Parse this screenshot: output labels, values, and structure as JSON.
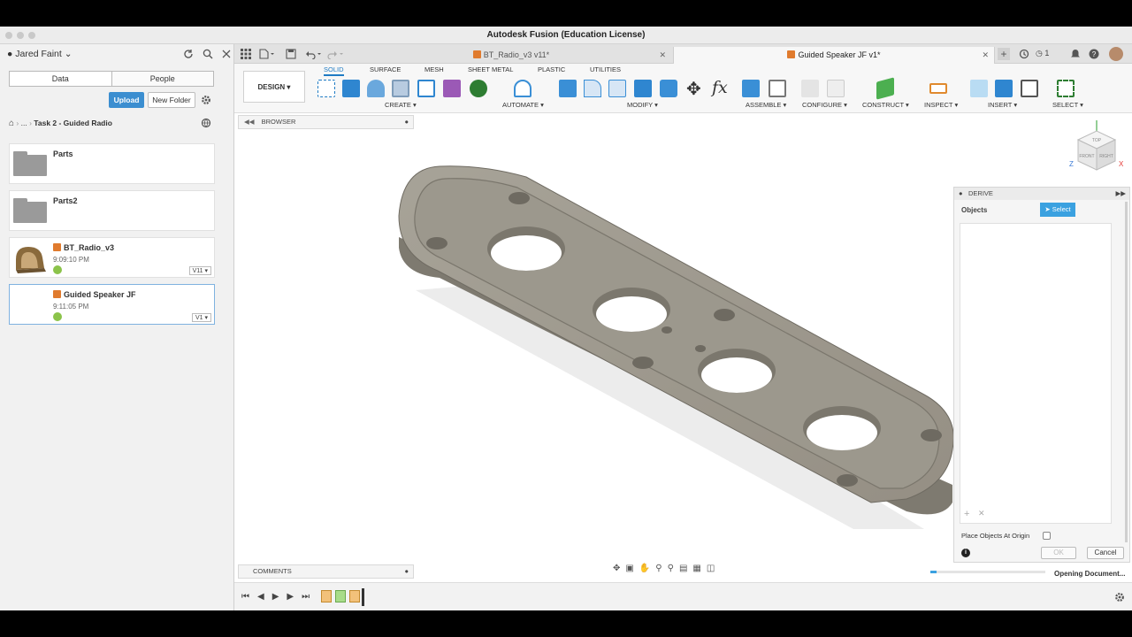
{
  "window": {
    "title": "Autodesk Fusion (Education License)"
  },
  "data_panel": {
    "user": "Jared Faint",
    "tabs": [
      "Data",
      "People"
    ],
    "upload_label": "Upload",
    "new_folder_label": "New Folder",
    "breadcrumb_ellipsis": "...",
    "breadcrumb_current": "Task 2 - Guided Radio",
    "items": [
      {
        "name": "Parts",
        "type": "folder"
      },
      {
        "name": "Parts2",
        "type": "folder"
      },
      {
        "name": "BT_Radio_v3",
        "time": "9:09:10 PM",
        "version": "V11"
      },
      {
        "name": "Guided Speaker JF",
        "time": "9:11:05 PM",
        "version": "V1"
      }
    ]
  },
  "doc_tabs": [
    {
      "label": "BT_Radio_v3 v11*"
    },
    {
      "label": "Guided Speaker JF v1*"
    }
  ],
  "header_status": {
    "jobs_count": "1"
  },
  "toolbar": {
    "workspace": "DESIGN",
    "subtabs": [
      "SOLID",
      "SURFACE",
      "MESH",
      "SHEET METAL",
      "PLASTIC",
      "UTILITIES"
    ],
    "groups": [
      "CREATE",
      "AUTOMATE",
      "MODIFY",
      "ASSEMBLE",
      "CONFIGURE",
      "CONSTRUCT",
      "INSPECT",
      "INSERT",
      "SELECT"
    ]
  },
  "browser": {
    "label": "BROWSER"
  },
  "comments": {
    "label": "COMMENTS"
  },
  "viewcube": {
    "top": "TOP",
    "front": "FRONT",
    "right": "RIGHT",
    "axis_x": "X",
    "axis_z": "Z"
  },
  "derive_dialog": {
    "title": "DERIVE",
    "objects_label": "Objects",
    "select_label": "Select",
    "place_origin_label": "Place Objects At Origin",
    "ok_label": "OK",
    "cancel_label": "Cancel"
  },
  "status": {
    "text": "Opening Document...",
    "progress": 0.05
  },
  "colors": {
    "accent": "#1f7bc4",
    "select_btn": "#3ba1e0",
    "upload": "#3b8ed0",
    "part": "#9e9b92"
  }
}
